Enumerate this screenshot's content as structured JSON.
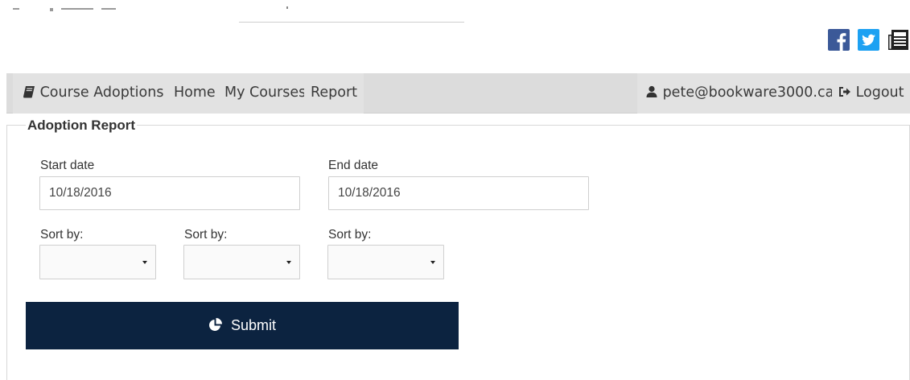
{
  "navbar": {
    "brand_label": "Course Adoptions",
    "brand_icon": "book-icon",
    "items": [
      {
        "label": "Home"
      },
      {
        "label": "My Courses"
      },
      {
        "label": "Report"
      }
    ],
    "user_email": "pete@bookware3000.ca",
    "user_icon": "user-icon",
    "logout_label": "Logout",
    "logout_icon": "sign-out-icon",
    "background": "#dcdcdc"
  },
  "social": {
    "icons": [
      "facebook-icon",
      "twitter-icon",
      "newspaper-icon"
    ],
    "colors": {
      "facebook": "#3b5998",
      "twitter": "#1da1f2"
    }
  },
  "report": {
    "title": "Adoption Report",
    "start_date": {
      "label": "Start date",
      "value": "10/18/2016"
    },
    "end_date": {
      "label": "End date",
      "value": "10/18/2016"
    },
    "sort_fields": [
      {
        "label": "Sort by:",
        "value": ""
      },
      {
        "label": "Sort by:",
        "value": ""
      },
      {
        "label": "Sort by:",
        "value": ""
      }
    ],
    "submit_label": "Submit",
    "submit_icon": "pie-chart-icon",
    "submit_color": "#0c2340"
  }
}
